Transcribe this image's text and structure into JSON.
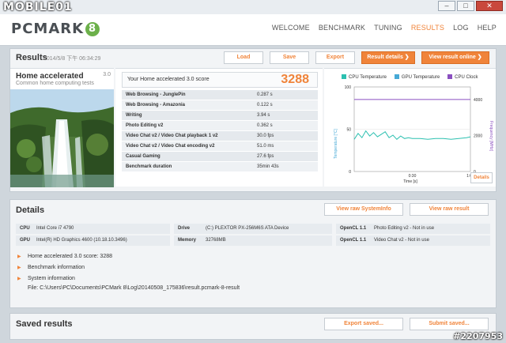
{
  "watermark": {
    "text": "MOBILE01",
    "id": "#2207953"
  },
  "window": {
    "min": "–",
    "max": "□",
    "close": "✕"
  },
  "app": {
    "logo": "PCMARK",
    "logo_badge": "8"
  },
  "nav": [
    "WELCOME",
    "BENCHMARK",
    "TUNING",
    "RESULTS",
    "LOG",
    "HELP"
  ],
  "nav_active": "RESULTS",
  "colors": {
    "accent": "#f0843a",
    "cpu_temp": "#2cc0b0",
    "gpu_temp": "#47a9d6",
    "cpu_clock": "#8a4fc0"
  },
  "results": {
    "title": "Results",
    "timestamp": "2014/5/8 下午 06:34:29",
    "buttons": {
      "load": "Load",
      "save": "Save",
      "export": "Export",
      "result_details": "Result details ❯",
      "view_online": "View result online ❯"
    }
  },
  "home": {
    "title": "Home accelerated",
    "subtitle": "Common home computing tests",
    "version": "3.0"
  },
  "score": {
    "label": "Your Home accelerated 3.0 score",
    "value": "3288",
    "rows": [
      {
        "name": "Web Browsing - JunglePin",
        "value": "0.287 s"
      },
      {
        "name": "Web Browsing - Amazonia",
        "value": "0.122 s"
      },
      {
        "name": "Writing",
        "value": "3.94 s"
      },
      {
        "name": "Photo Editing v2",
        "value": "0.362 s"
      },
      {
        "name": "Video Chat v2 / Video Chat playback 1 v2",
        "value": "30.0 fps"
      },
      {
        "name": "Video Chat v2 / Video Chat encoding v2",
        "value": "51.0 ms"
      },
      {
        "name": "Casual Gaming",
        "value": "27.6 fps"
      },
      {
        "name": "Benchmark duration",
        "value": "35min 43s"
      }
    ]
  },
  "chart": {
    "legend": [
      "CPU Temperature",
      "GPU Temperature",
      "CPU Clock"
    ],
    "left_axis_label": "Temperature [°C]",
    "right_axis_label": "Frequency [MHz]",
    "x_axis_label": "Time [s]",
    "details": "Details"
  },
  "chart_data": {
    "type": "line",
    "x_ticks": [
      "0:30",
      "1:00"
    ],
    "y_left_ticks": [
      "100",
      "50",
      "0"
    ],
    "y_right_ticks": [
      "4000",
      "2000",
      "0"
    ],
    "ylim_left": [
      0,
      100
    ],
    "ylim_right": [
      0,
      4700
    ],
    "x_range": [
      0,
      60
    ],
    "series": [
      {
        "name": "CPU Temperature",
        "axis": "left",
        "x": [
          0,
          2,
          4,
          6,
          8,
          10,
          12,
          14,
          16,
          18,
          20,
          22,
          24,
          26,
          28,
          30,
          34,
          38,
          42,
          46,
          50,
          54,
          58,
          60
        ],
        "y": [
          38,
          45,
          40,
          48,
          42,
          46,
          41,
          44,
          47,
          40,
          43,
          38,
          42,
          39,
          40,
          39,
          39,
          38,
          39,
          39,
          38,
          39,
          40,
          41
        ]
      },
      {
        "name": "CPU Clock",
        "axis": "right",
        "x": [
          0,
          60
        ],
        "y": [
          4000,
          4000
        ]
      }
    ]
  },
  "details": {
    "title": "Details",
    "view_sysinfo": "View raw SystemInfo",
    "view_result": "View raw result",
    "sys": [
      {
        "key": "CPU",
        "value": "Intel Core i7 4790"
      },
      {
        "key": "GPU",
        "value": "Intel(R) HD Graphics 4600 (10.18.10.3496)"
      },
      {
        "key": "Drive",
        "value": "(C:) PLEXTOR PX-256M6S ATA Device"
      },
      {
        "key": "Memory",
        "value": "32768MB"
      },
      {
        "key": "OpenCL 1.1",
        "value": "Photo Editing v2 - Not in use"
      },
      {
        "key": "OpenCL 1.1",
        "value": "Video Chat v2 - Not in use"
      }
    ],
    "expanders": [
      "Home accelerated 3.0 score: 3288",
      "Benchmark information",
      "System information"
    ],
    "file": "File: C:\\Users\\PC\\Documents\\PCMark 8\\Log\\20140508_175836\\result.pcmark-8-result"
  },
  "saved": {
    "title": "Saved results",
    "export": "Export saved...",
    "submit": "Submit saved..."
  }
}
